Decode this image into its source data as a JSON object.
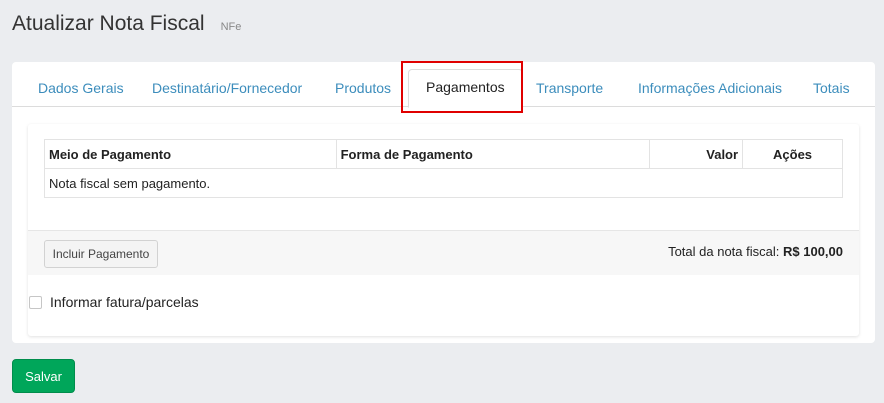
{
  "header": {
    "title": "Atualizar Nota Fiscal",
    "subtitle": "NFe"
  },
  "tabs": [
    {
      "label": "Dados Gerais"
    },
    {
      "label": "Destinatário/Fornecedor"
    },
    {
      "label": "Produtos"
    },
    {
      "label": "Pagamentos",
      "active": true
    },
    {
      "label": "Transporte"
    },
    {
      "label": "Informações Adicionais"
    },
    {
      "label": "Totais"
    }
  ],
  "payments_table": {
    "columns": [
      "Meio de Pagamento",
      "Forma de Pagamento",
      "Valor",
      "Ações"
    ],
    "empty_message": "Nota fiscal sem pagamento."
  },
  "footer": {
    "include_button": "Incluir Pagamento",
    "total_label": "Total da nota fiscal:",
    "total_value": "R$ 100,00"
  },
  "invoice_checkbox": {
    "label": "Informar fatura/parcelas",
    "checked": false
  },
  "save_button": "Salvar",
  "colors": {
    "link": "#3c8dbc",
    "save_button": "#00a65a",
    "highlight": "#e00000",
    "background": "#ebedf0"
  }
}
